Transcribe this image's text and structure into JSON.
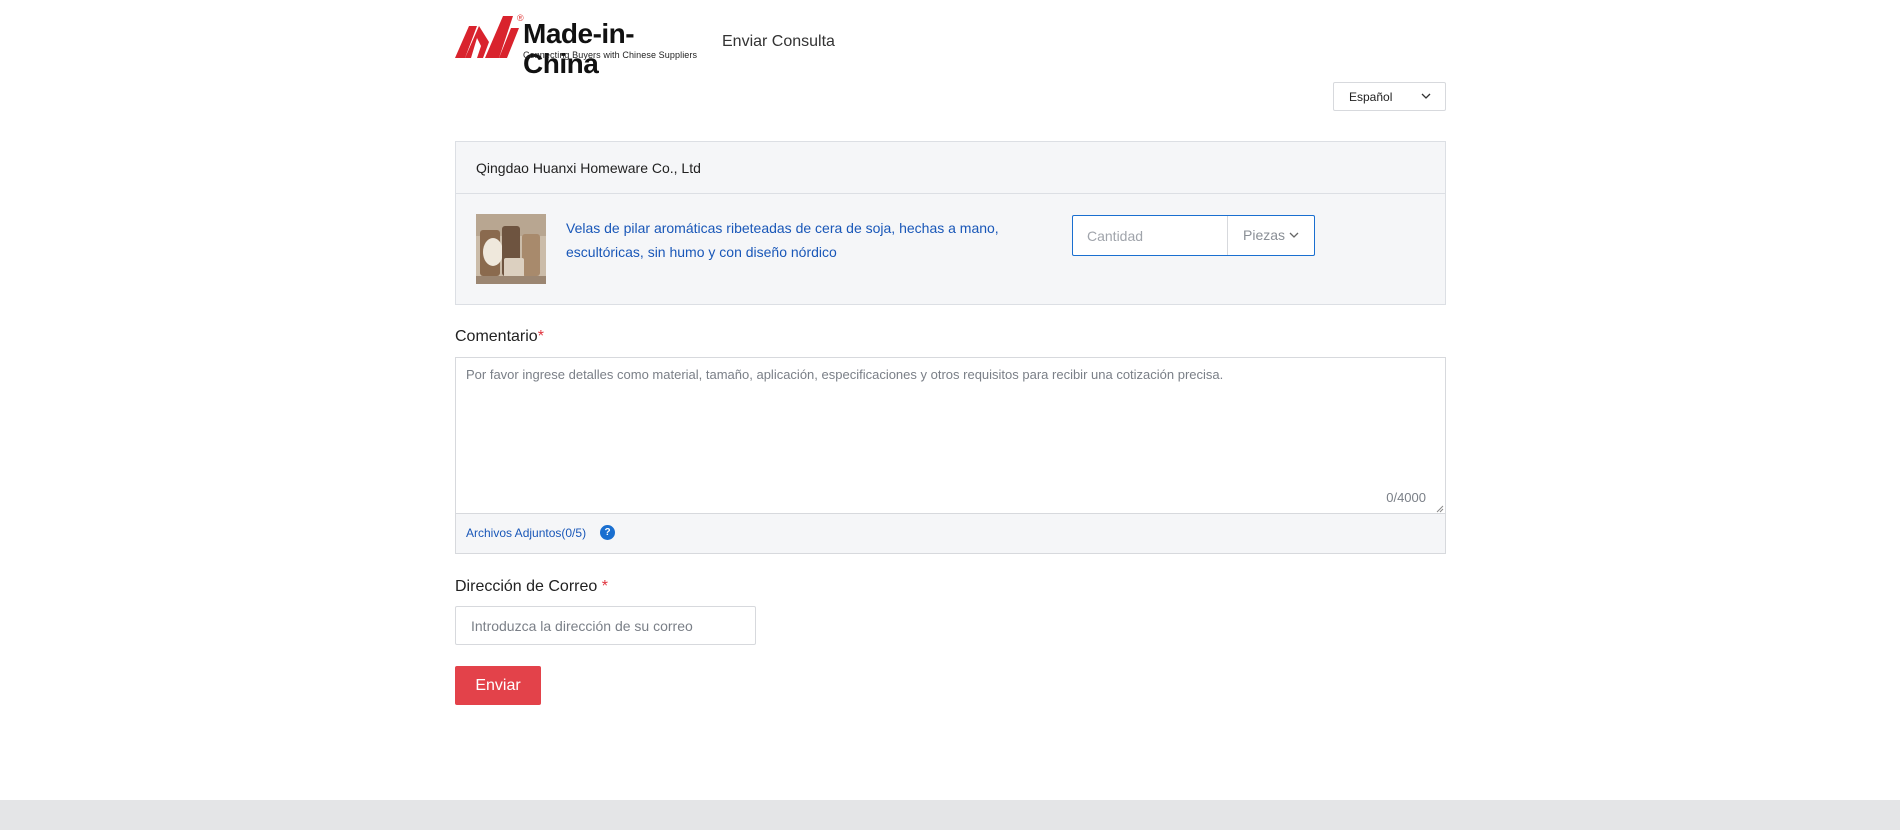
{
  "header": {
    "logo_text": "Made-in-China",
    "logo_registered": "®",
    "logo_tagline": "Connecting Buyers with Chinese Suppliers",
    "page_title": "Enviar Consulta"
  },
  "language": {
    "selected": "Español"
  },
  "product_card": {
    "supplier": "Qingdao Huanxi Homeware Co., Ltd",
    "product_title": "Velas de pilar aromáticas ribeteadas de cera de soja, hechas a mano, escultóricas, sin humo y con diseño nórdico",
    "quantity": {
      "placeholder": "Cantidad",
      "value": ""
    },
    "unit": {
      "selected": "Piezas"
    }
  },
  "comment": {
    "label": "Comentario",
    "required_mark": "*",
    "placeholder": "Por favor ingrese detalles como material, tamaño, aplicación, especificaciones y otros requisitos para recibir una cotización precisa.",
    "value": "",
    "counter": "0/4000",
    "attachments_label": "Archivos Adjuntos(0/5)",
    "help_glyph": "?"
  },
  "email": {
    "label": "Dirección de Correo ",
    "required_mark": "*",
    "placeholder": "Introduzca la dirección de su correo",
    "value": ""
  },
  "submit_label": "Enviar",
  "colors": {
    "brand_red": "#e3424a",
    "link_blue": "#1957b8",
    "focus_blue": "#1a6fd0",
    "panel_bg": "#f5f6f8"
  },
  "icons": {
    "logo": "made-in-china-logo-icon",
    "language_dropdown": "chevron-down-icon",
    "unit_dropdown": "chevron-down-icon",
    "help": "question-circle-icon"
  }
}
